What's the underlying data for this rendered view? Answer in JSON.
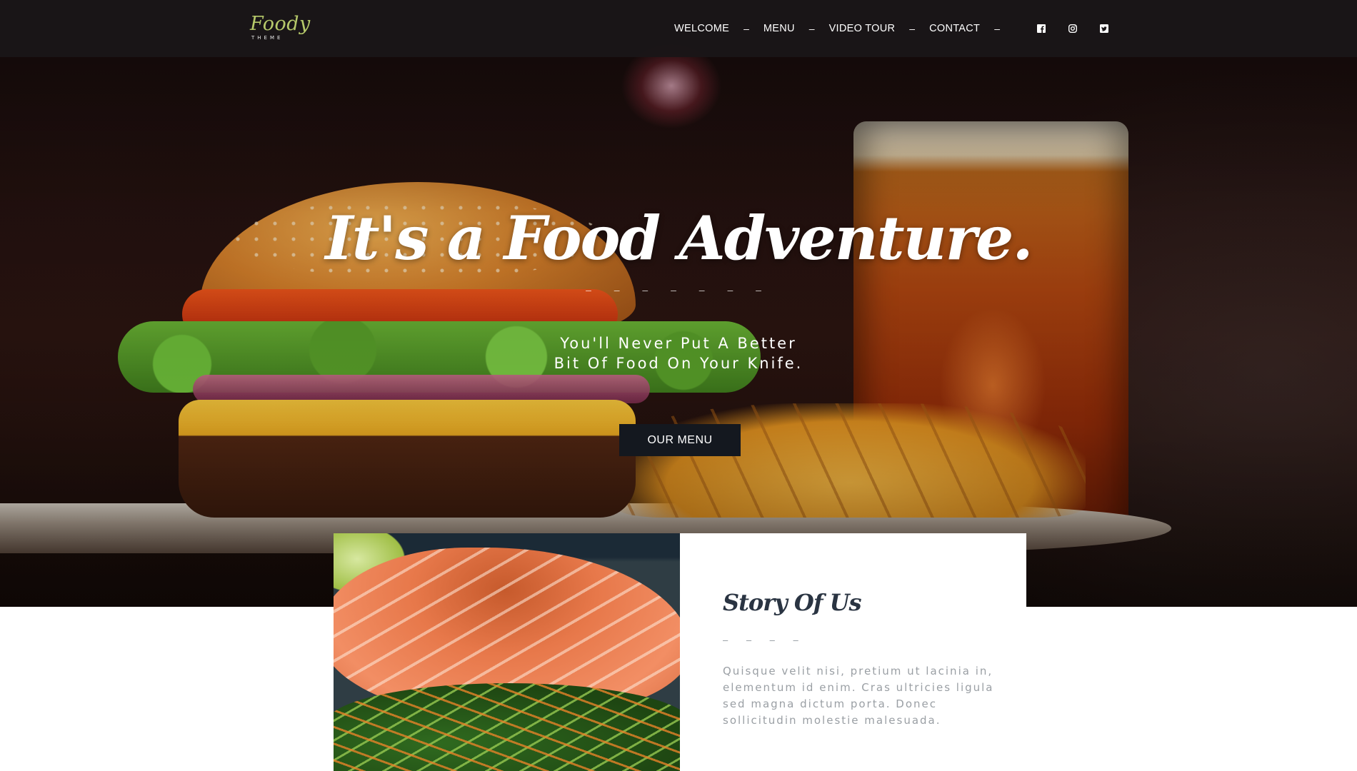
{
  "brand": {
    "logo_script": "Foody",
    "logo_sub": "THEME",
    "logo_color": "#b6c96a"
  },
  "nav": {
    "items": [
      {
        "label": "WELCOME"
      },
      {
        "label": "MENU"
      },
      {
        "label": "VIDEO TOUR"
      },
      {
        "label": "CONTACT"
      }
    ],
    "separator": "–",
    "social": [
      "facebook-icon",
      "instagram-icon",
      "twitter-icon"
    ]
  },
  "hero": {
    "title": "It's a Food Adventure.",
    "dashes": "– – – – – – –",
    "subtitle_line1": "You'll Never Put A Better",
    "subtitle_line2": "Bit Of Food On Your Knife.",
    "cta_label": "OUR MENU"
  },
  "story": {
    "title": "Story Of Us",
    "dashes": "– – – –",
    "text": "Quisque velit nisi, pretium ut lacinia in, elementum id enim. Cras ultricies ligula sed magna dictum porta. Donec sollicitudin molestie malesuada."
  },
  "colors": {
    "nav_bg": "#1a1618",
    "cta_bg": "#14181f",
    "heading": "#2a3442",
    "body_text": "#9a9fa4"
  }
}
